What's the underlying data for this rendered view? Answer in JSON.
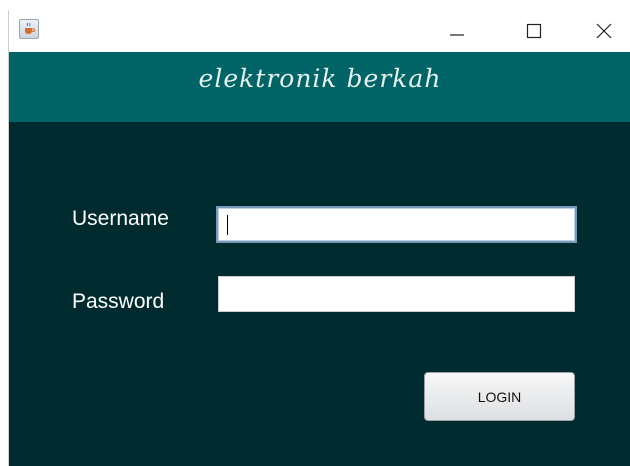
{
  "window": {
    "app_icon": "java-cup-icon",
    "controls": [
      "minimize-icon",
      "maximize-icon",
      "close-icon"
    ]
  },
  "header": {
    "title": "elektronik berkah"
  },
  "form": {
    "username_label": "Username",
    "username_value": "",
    "password_label": "Password",
    "password_value": "",
    "login_label": "LOGIN"
  },
  "colors": {
    "header_bg": "#006466",
    "content_bg": "#002b2e",
    "label_text": "#ffffff"
  }
}
